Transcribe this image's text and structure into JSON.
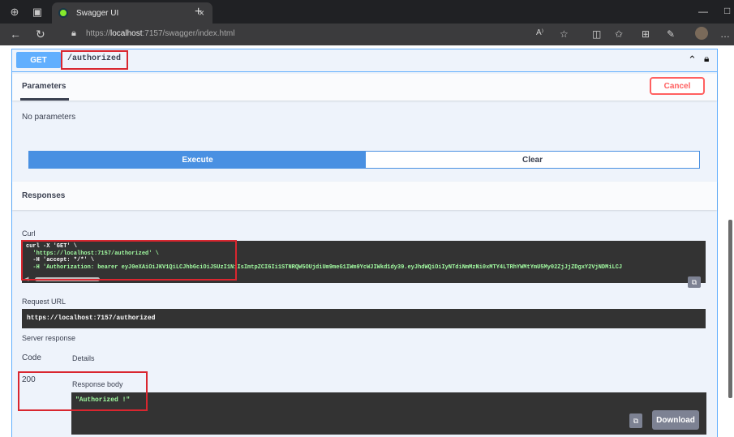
{
  "browser": {
    "tab_title": "Swagger UI",
    "tab_close": "×",
    "new_tab": "+",
    "minimize": "—",
    "maximize": "□",
    "url_prefix": "https://",
    "url_host": "localhost",
    "url_rest": ":7157/swagger/index.html",
    "read_aloud": "A⁾",
    "icons": [
      "back-icon",
      "refresh-icon",
      "lock-icon",
      "favorite-icon",
      "split-screen-icon",
      "favorites-icon",
      "collections-icon",
      "extensions-icon",
      "profile-icon"
    ]
  },
  "endpoint": {
    "method": "GET",
    "path": "/authorized",
    "collapse_icon": "chevron-up-icon",
    "lock_icon": "lock-icon"
  },
  "parameters": {
    "tab_label": "Parameters",
    "cancel_label": "Cancel",
    "empty_text": "No parameters",
    "execute_label": "Execute",
    "clear_label": "Clear"
  },
  "responses": {
    "heading": "Responses",
    "curl_label": "Curl",
    "curl_lines": [
      "curl -X 'GET' \\",
      "  'https://localhost:7157/authorized' \\",
      "  -H 'accept: */*' \\",
      "  -H 'Authorization: bearer eyJ0eXAiOiJKV1QiLCJhbGciOiJSUzI1NiIsImtpZCI6Ii1STNRQW5OUjdiUm9meG1IWm9YcWJIWkd1dy39.eyJhdWQiOiIyNTdiNmMzNi0xMTY4LTRhYWMtYmU5My02ZjJjZDgxY2VjNDMiLCJ"
    ],
    "request_url_label": "Request URL",
    "request_url": "https://localhost:7157/authorized",
    "server_response_label": "Server response",
    "col_code": "Code",
    "col_details": "Details",
    "status_code": "200",
    "response_body_label": "Response body",
    "response_body": "\"Authorized !\"",
    "download_label": "Download"
  },
  "colors": {
    "get_method": "#61affe",
    "execute": "#4990e2",
    "cancel": "#ff6060",
    "highlight_box": "#d9262f",
    "code_bg": "#333333",
    "code_string": "#a2fca2"
  }
}
